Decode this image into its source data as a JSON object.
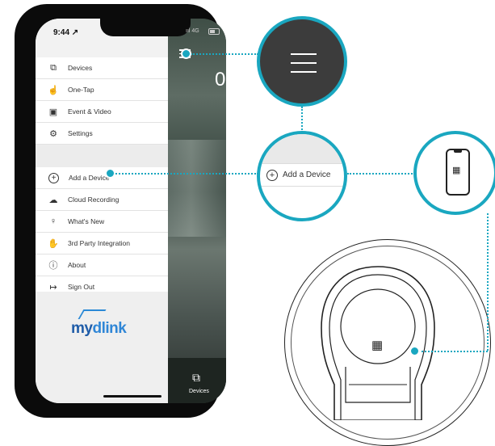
{
  "status_bar": {
    "time": "9:44 ↗",
    "signal": "ııl 4G"
  },
  "background": {
    "partial_text": "0"
  },
  "drawer": {
    "groups": [
      {
        "items": [
          {
            "label": "Devices",
            "icon": "devices-icon",
            "glyph": "⧉"
          },
          {
            "label": "One-Tap",
            "icon": "touch-icon",
            "glyph": "☝"
          },
          {
            "label": "Event & Video",
            "icon": "event-video-icon",
            "glyph": "▣"
          },
          {
            "label": "Settings",
            "icon": "gear-icon",
            "glyph": "⚙"
          }
        ]
      },
      {
        "items": [
          {
            "label": "Add a Device",
            "icon": "plus-circle-icon",
            "glyph": "+"
          },
          {
            "label": "Cloud Recording",
            "icon": "cloud-icon",
            "glyph": "☁"
          },
          {
            "label": "What's New",
            "icon": "lightbulb-icon",
            "glyph": "♀"
          },
          {
            "label": "3rd Party Integration",
            "icon": "handshake-icon",
            "glyph": "✋"
          },
          {
            "label": "About",
            "icon": "info-icon",
            "glyph": "ⓘ"
          },
          {
            "label": "Sign Out",
            "icon": "sign-out-icon",
            "glyph": "↦"
          }
        ]
      }
    ],
    "logo": {
      "prefix": "my",
      "suffix": "dlink"
    }
  },
  "dock": {
    "label": "Devices",
    "icon": "devices-icon",
    "glyph": "⧉"
  },
  "zoom": {
    "menu_icon": "hamburger-menu-icon",
    "add_device_label": "Add a Device",
    "phone_icon": "phone-qr-icon",
    "qr_glyph": "▦"
  },
  "colors": {
    "accent": "#1aa7c0",
    "drawer_bg": "#f2f2f2",
    "logo_blue": "#1f5ca8"
  }
}
